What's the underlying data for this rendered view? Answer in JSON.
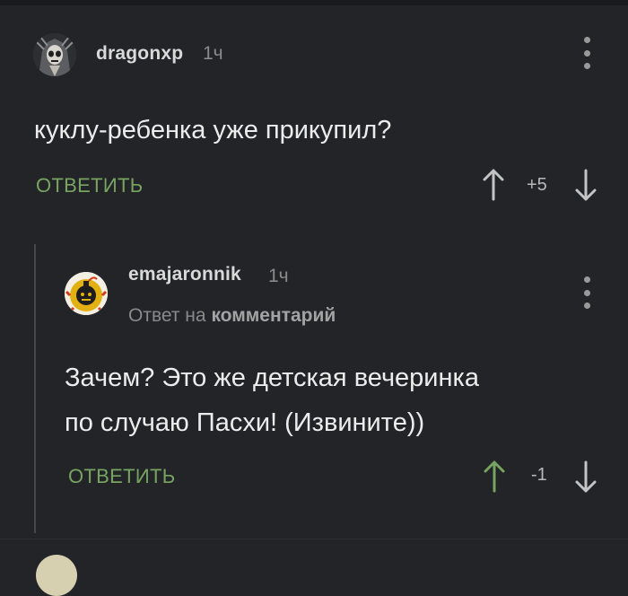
{
  "comments": [
    {
      "author": "dragonxp",
      "time": "1ч",
      "text": "куклу-ребенка уже прикупил?",
      "reply_label": "ОТВЕТИТЬ",
      "score": "+5",
      "avatar_icon": "skull-avatar-icon"
    },
    {
      "author": "emajaronnik",
      "time": "1ч",
      "reply_to_prefix": "Ответ на",
      "reply_to_link": "комментарий",
      "text_line1": "Зачем? Это же детская вечеринка",
      "text_line2": "по случаю Пасхи! (Извините))",
      "reply_label": "ОТВЕТИТЬ",
      "score": "-1",
      "avatar_icon": "bomb-avatar-icon"
    }
  ],
  "colors": {
    "background": "#232428",
    "accent": "#77a561",
    "upvote_active": "#77a561"
  }
}
